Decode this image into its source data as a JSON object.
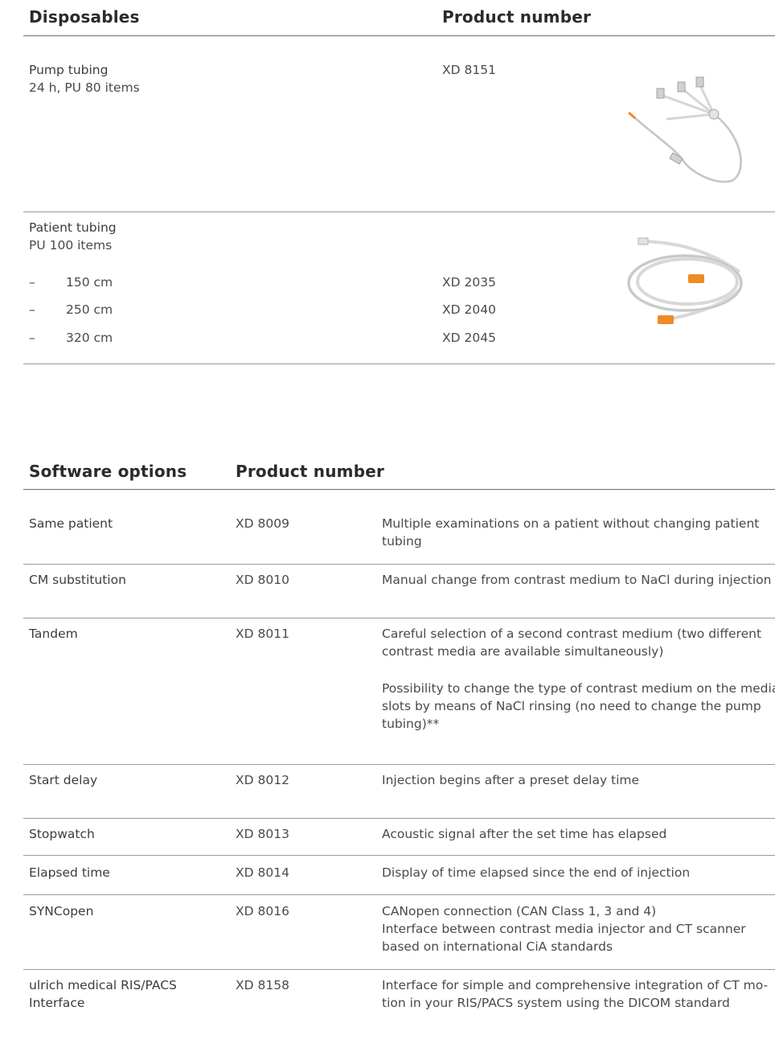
{
  "disposables": {
    "header_left": "Disposables",
    "header_right": "Product number",
    "pump": {
      "name": "Pump tubing",
      "detail": "24 h, PU 80 items",
      "number": "XD 8151",
      "image_icon": "pump-tubing-image"
    },
    "patient": {
      "name": "Patient tubing",
      "detail": "PU 100 items",
      "image_icon": "patient-tubing-image",
      "variants": [
        {
          "dash": "–",
          "length": "150 cm",
          "number": "XD 2035"
        },
        {
          "dash": "–",
          "length": "250 cm",
          "number": "XD 2040"
        },
        {
          "dash": "–",
          "length": "320 cm",
          "number": "XD 2045"
        }
      ]
    }
  },
  "software": {
    "header_left": "Software options",
    "header_right": "Product number",
    "rows": [
      {
        "name": [
          "Same patient"
        ],
        "number": "XD 8009",
        "desc": [
          "Multiple examinations on a patient without changing patient",
          "tubing"
        ]
      },
      {
        "name": [
          "CM substitution"
        ],
        "number": "XD 8010",
        "desc": [
          "Manual change from contrast medium to NaCl during injection"
        ]
      },
      {
        "name": [
          "Tandem"
        ],
        "number": "XD 8011",
        "desc": [
          "Careful selection of a second contrast medium (two different",
          "contrast media are available simultaneously)"
        ],
        "desc2": [
          "Possibility to change the type of contrast medium on the media",
          "slots by means of NaCl rinsing (no need to change the pump",
          "tubing)**"
        ]
      },
      {
        "name": [
          "Start delay"
        ],
        "number": "XD 8012",
        "desc": [
          "Injection begins after a preset delay time"
        ]
      },
      {
        "name": [
          "Stopwatch"
        ],
        "number": "XD 8013",
        "desc": [
          "Acoustic signal after the set time has elapsed"
        ]
      },
      {
        "name": [
          "Elapsed time"
        ],
        "number": "XD 8014",
        "desc": [
          "Display of time elapsed since the end of injection"
        ]
      },
      {
        "name": [
          "SYNCopen"
        ],
        "number": "XD 8016",
        "desc": [
          "CANopen connection (CAN Class 1, 3 and 4)",
          "Interface between contrast media injector and CT scanner",
          "based on international CiA standards"
        ]
      },
      {
        "name": [
          "ulrich medical RIS/PACS",
          "Interface"
        ],
        "number": "XD 8158",
        "desc": [
          "Interface for simple and comprehensive integration of CT mo-",
          "tion in your RIS/PACS system using the DICOM standard"
        ]
      }
    ]
  },
  "colors": {
    "accent_orange": "#f08a24",
    "text": "#3c3c3c",
    "rule": "#9a9a9a"
  }
}
